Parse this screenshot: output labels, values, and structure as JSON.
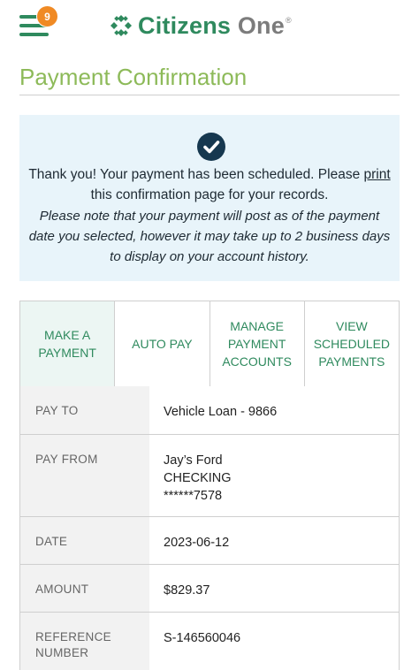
{
  "header": {
    "notification_count": "9",
    "brand_main": "Citizens",
    "brand_secondary": "One",
    "brand_mark": "®"
  },
  "page": {
    "title": "Payment Confirmation"
  },
  "confirmation": {
    "line1_before_link": "Thank you! Your payment has been scheduled. Please ",
    "link_text": "print",
    "line1_after_link": " this confirmation page for your records.",
    "note": "Please note that your payment will post as of the payment date you selected, however it may take up to 2 business days to display on your account history."
  },
  "tabs": [
    {
      "label": "MAKE A PAYMENT",
      "active": true
    },
    {
      "label": "AUTO PAY",
      "active": false
    },
    {
      "label": "MANAGE PAYMENT ACCOUNTS",
      "active": false
    },
    {
      "label": "VIEW SCHEDULED PAYMENTS",
      "active": false
    }
  ],
  "details": {
    "pay_to": {
      "label": "PAY TO",
      "value": "Vehicle Loan - 9866"
    },
    "pay_from": {
      "label": "PAY FROM",
      "name": "Jay’s Ford",
      "type": "CHECKING",
      "account": "******7578"
    },
    "date": {
      "label": "DATE",
      "value": "2023-06-12"
    },
    "amount": {
      "label": "AMOUNT",
      "value": "$829.37"
    },
    "reference": {
      "label": "REFERENCE NUMBER",
      "value": "S-146560046"
    }
  },
  "colors": {
    "brand_green": "#2f8a5e",
    "title_green": "#8dba59",
    "badge_orange": "#f08a24",
    "confirm_bg": "#e8f4fa",
    "check_navy": "#16384f"
  },
  "icons": [
    "hamburger-menu-icon",
    "citizens-logo-icon",
    "checkmark-circle-icon"
  ]
}
